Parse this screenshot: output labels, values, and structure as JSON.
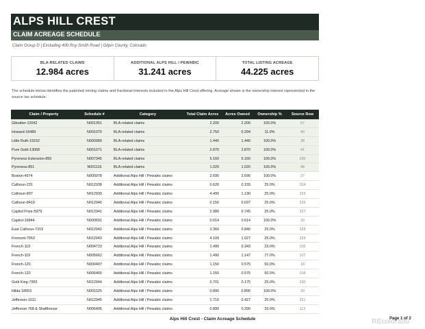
{
  "title": "ALPS HILL CREST",
  "subtitle": "CLAIM ACREAGE SCHEDULE",
  "meta": "Claim Group D | Excluding 400 Roy Smith Road | Gilpin County, Colorado",
  "summary": [
    {
      "label": "BLA-RELATED CLAIMS",
      "value": "12.984 acres"
    },
    {
      "label": "ADDITIONAL ALPS HILL / PEWABIC",
      "value": "31.241 acres"
    },
    {
      "label": "TOTAL LISTING ACREAGE",
      "value": "44.225 acres"
    }
  ],
  "intro": "The schedule below identifies the patented mining claims and fractional interests included in the Alps Hill Crest offering. Acreage shown is the ownership interest represented in the source tax schedule.",
  "table": {
    "headers": [
      "Claim / Property",
      "Schedule #",
      "Category",
      "Total Claim Acres",
      "Acres Owned",
      "Ownership %",
      "Source Row"
    ],
    "rows": [
      {
        "name": "Gibralter-12042",
        "schedule": "N001351",
        "category": "BLA-related claims",
        "total": "2.200",
        "owned": "2.200",
        "pct": "100.0%",
        "src": "57",
        "bla": true
      },
      {
        "name": "Howard-16489",
        "schedule": "N001070",
        "category": "BLA-related claims",
        "total": "2.750",
        "owned": "0.294",
        "pct": "11.0%",
        "src": "40",
        "bla": true
      },
      {
        "name": "Little Ruth-19152",
        "schedule": "N000989",
        "category": "BLA-related claims",
        "total": "1.440",
        "owned": "1.440",
        "pct": "100.0%",
        "src": "38",
        "bla": true
      },
      {
        "name": "Pure Gold-13068",
        "schedule": "N001071",
        "category": "BLA-related claims",
        "total": "2.870",
        "owned": "2.870",
        "pct": "100.0%",
        "src": "41",
        "bla": true
      },
      {
        "name": "Pyreness Extension-850",
        "schedule": "N007345",
        "category": "BLA-related claims",
        "total": "5.160",
        "owned": "5.160",
        "pct": "100.0%",
        "src": "230",
        "bla": true
      },
      {
        "name": "Pyreness-851",
        "schedule": "N001116",
        "category": "BLA-related claims",
        "total": "1.020",
        "owned": "1.020",
        "pct": "100.0%",
        "src": "48",
        "bla": true
      },
      {
        "name": "Boston-4974",
        "schedule": "N000978",
        "category": "Additional Alps Hill / Pewabic claims",
        "total": "2.690",
        "owned": "2.690",
        "pct": "100.0%",
        "src": "37",
        "bla": false
      },
      {
        "name": "Calhoun-231",
        "schedule": "N012938",
        "category": "Additional Alps Hill / Pewabic claims",
        "total": "0.620",
        "owned": "0.155",
        "pct": "25.0%",
        "src": "324",
        "bla": false
      },
      {
        "name": "Calhoun-837",
        "schedule": "N012939",
        "category": "Additional Alps Hill / Pewabic claims",
        "total": "4.490",
        "owned": "1.130",
        "pct": "25.0%",
        "src": "325",
        "bla": false
      },
      {
        "name": "Calhoun-8419",
        "schedule": "N012940",
        "category": "Additional Alps Hill / Pewabic claims",
        "total": "0.150",
        "owned": "0.037",
        "pct": "25.0%",
        "src": "326",
        "bla": false
      },
      {
        "name": "Capitol Prize-5979",
        "schedule": "N012941",
        "category": "Additional Alps Hill / Pewabic claims",
        "total": "2.980",
        "owned": "0.745",
        "pct": "25.0%",
        "src": "327",
        "bla": false
      },
      {
        "name": "Capitol-16844",
        "schedule": "N000691",
        "category": "Additional Alps Hill / Pewabic claims",
        "total": "0.614",
        "owned": "0.614",
        "pct": "100.0%",
        "src": "30",
        "bla": false
      },
      {
        "name": "East Calhoun-7319",
        "schedule": "N012942",
        "category": "Additional Alps Hill / Pewabic claims",
        "total": "3.360",
        "owned": "0.840",
        "pct": "25.0%",
        "src": "328",
        "bla": false
      },
      {
        "name": "Fremont-7953",
        "schedule": "N012943",
        "category": "Additional Alps Hill / Pewabic claims",
        "total": "4.109",
        "owned": "1.027",
        "pct": "25.0%",
        "src": "329",
        "bla": false
      },
      {
        "name": "French-119",
        "schedule": "N004723",
        "category": "Additional Alps Hill / Pewabic claims",
        "total": "1.490",
        "owned": "0.343",
        "pct": "23.0%",
        "src": "105",
        "bla": false
      },
      {
        "name": "French-119",
        "schedule": "N005662",
        "category": "Additional Alps Hill / Pewabic claims",
        "total": "1.490",
        "owned": "1.147",
        "pct": "77.0%",
        "src": "107",
        "bla": false
      },
      {
        "name": "French-120",
        "schedule": "N000407",
        "category": "Additional Alps Hill / Pewabic claims",
        "total": "1.150",
        "owned": "0.575",
        "pct": "50.0%",
        "src": "18",
        "bla": false
      },
      {
        "name": "French-120",
        "schedule": "N006465",
        "category": "Additional Alps Hill / Pewabic claims",
        "total": "1.150",
        "owned": "0.575",
        "pct": "50.0%",
        "src": "108",
        "bla": false
      },
      {
        "name": "Gold King-7953",
        "schedule": "N012944",
        "category": "Additional Alps Hill / Pewabic claims",
        "total": "0.701",
        "owned": "0.175",
        "pct": "25.0%",
        "src": "330",
        "bla": false
      },
      {
        "name": "Hilda-18953",
        "schedule": "N001025",
        "category": "Additional Alps Hill / Pewabic claims",
        "total": "0.890",
        "owned": "0.890",
        "pct": "100.0%",
        "src": "39",
        "bla": false
      },
      {
        "name": "Jefferson-1011",
        "schedule": "N012945",
        "category": "Additional Alps Hill / Pewabic claims",
        "total": "1.710",
        "owned": "0.427",
        "pct": "25.0%",
        "src": "331",
        "bla": false
      },
      {
        "name": "Jefferson-768 & Shafthouse",
        "schedule": "N006495",
        "category": "Additional Alps Hill / Pewabic claims",
        "total": "0.890",
        "owned": "0.290",
        "pct": "33.0%",
        "src": "112",
        "bla": false
      }
    ]
  },
  "footer": "Alps Hill Crest - Claim Acreage Schedule",
  "page_number": "Page 1 of 2",
  "watermark": "REcolorado",
  "colors": {
    "banner": "#1f2a24",
    "subbanner": "#4a5a4c",
    "bla_row": "#eef0ea"
  }
}
